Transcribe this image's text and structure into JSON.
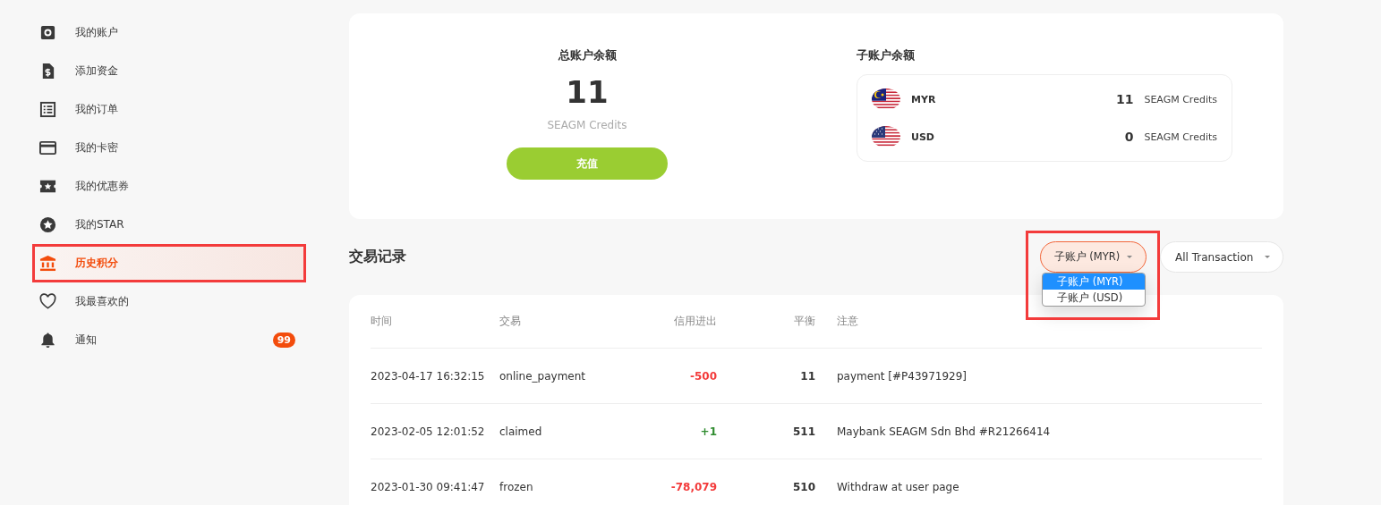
{
  "sidebar": {
    "items": [
      {
        "label": "我的账户",
        "selected": false,
        "annotated": false
      },
      {
        "label": "添加资金",
        "selected": false,
        "annotated": false
      },
      {
        "label": "我的订单",
        "selected": false,
        "annotated": false
      },
      {
        "label": "我的卡密",
        "selected": false,
        "annotated": false
      },
      {
        "label": "我的优惠券",
        "selected": false,
        "annotated": false
      },
      {
        "label": "我的STAR",
        "selected": false,
        "annotated": false
      },
      {
        "label": "历史积分",
        "selected": true,
        "annotated": true
      },
      {
        "label": "我最喜欢的",
        "selected": false,
        "annotated": false
      },
      {
        "label": "通知",
        "selected": false,
        "annotated": false,
        "badge": "99"
      }
    ]
  },
  "balance": {
    "title": "总账户余额",
    "amount": "11",
    "unit": "SEAGM Credits",
    "button": "充值"
  },
  "sub_balances": {
    "title": "子账户余额",
    "accounts": [
      {
        "currency": "MYR",
        "amount": "11",
        "unit": "SEAGM Credits"
      },
      {
        "currency": "USD",
        "amount": "0",
        "unit": "SEAGM Credits"
      }
    ]
  },
  "transactions": {
    "title": "交易记录",
    "account_select": {
      "value": "子账户 (MYR)",
      "expanded": true,
      "annotated": true,
      "options": [
        {
          "label": "子账户 (MYR)",
          "selected": true
        },
        {
          "label": "子账户 (USD)",
          "selected": false
        }
      ]
    },
    "type_select": {
      "value": "All Transaction"
    },
    "columns": [
      "时间",
      "交易",
      "信用进出",
      "平衡",
      "注意"
    ],
    "rows": [
      {
        "time": "2023-04-17 16:32:15",
        "type": "online_payment",
        "change": "-500",
        "kind": "debit",
        "balance": "11",
        "note": "payment [#P43971929]"
      },
      {
        "time": "2023-02-05 12:01:52",
        "type": "claimed",
        "change": "+1",
        "kind": "credit",
        "balance": "511",
        "note": "Maybank SEAGM Sdn Bhd #R21266414"
      },
      {
        "time": "2023-01-30 09:41:47",
        "type": "frozen",
        "change": "-78,079",
        "kind": "debit",
        "balance": "510",
        "note": "Withdraw at user page"
      }
    ]
  }
}
